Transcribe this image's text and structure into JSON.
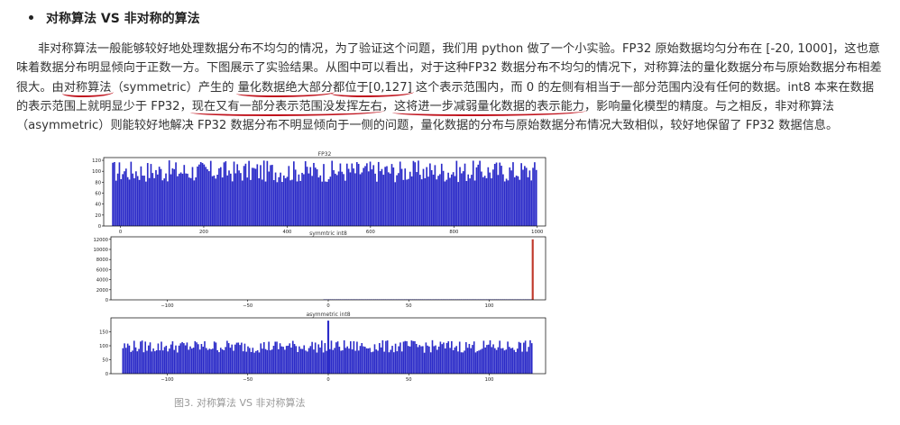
{
  "heading": "对称算法 VS 非对称的算法",
  "paragraph": [
    {
      "t": "非对称算法一般能够较好地处理数据分布不均匀的情况，为了验证这个问题，我们用 python 做了一个小实验。FP32 原始数据均匀分布在 [-20, 1000]，这也意味着数据分布明显倾向于正数一方。下图展示了实验结果。从图中可以看出，对于这种FP32 数据分布不均匀的情况下，对称算法的量化数据分布与原始数据分布相差很大。由"
    },
    {
      "t": "对称算法",
      "u": true
    },
    {
      "t": "（symmetric）产生的 "
    },
    {
      "t": "量化数据绝大部分",
      "u": true
    },
    {
      "t": "都位于[0,127]",
      "u": true
    },
    {
      "t": " 这个表示范围内，而 0 的左侧有相当于一部分范围内没有任何的数据。int8 本来在数据的表示范围上就明显少于 FP32，"
    },
    {
      "t": "现在又有一部分表示范围没发挥左右",
      "u": true
    },
    {
      "t": "，"
    },
    {
      "t": "这将进一步减弱量化数据的表示能力",
      "u": true
    },
    {
      "t": "，影响量化模型的精度。与之相反，非对称算法（asymmetric）则能较好地解决 FP32 数据分布不明显倾向于一侧的问题，量化数据的分布与原始数据分布情况大致相似，较好地保留了 FP32 数据信息。"
    }
  ],
  "caption": "图3. 对称算法 VS 非对称算法",
  "colors": {
    "bar": "#2b2bc8",
    "spike": "#c0392b"
  },
  "chart_data": [
    {
      "type": "bar",
      "title": "FP32",
      "xlim": [
        -40,
        1020
      ],
      "ylim": [
        0,
        125
      ],
      "xticks": [
        0,
        200,
        400,
        600,
        800,
        1000
      ],
      "yticks": [
        0,
        20,
        40,
        60,
        80,
        100,
        120
      ],
      "bins": {
        "start": -20,
        "end": 1000,
        "count": 256,
        "typical": 100,
        "min": 80,
        "max": 120
      }
    },
    {
      "type": "bar",
      "title": "symmtric int8",
      "xlim": [
        -135,
        135
      ],
      "ylim": [
        0,
        12500
      ],
      "xticks": [
        -100,
        -50,
        0,
        50,
        100
      ],
      "yticks": [
        0,
        2000,
        4000,
        6000,
        8000,
        10000,
        12000
      ],
      "bins": {
        "start": -3,
        "end": 127,
        "count": 130,
        "typical": 100
      },
      "spike": {
        "x": 127,
        "value": 12000
      }
    },
    {
      "type": "bar",
      "title": "asymmetric int8",
      "xlim": [
        -135,
        135
      ],
      "ylim": [
        0,
        200
      ],
      "xticks": [
        -100,
        -50,
        0,
        50,
        100
      ],
      "yticks": [
        0,
        50,
        100,
        150
      ],
      "bins": {
        "start": -128,
        "end": 127,
        "count": 256,
        "typical": 100,
        "min": 75,
        "max": 120
      },
      "spike": {
        "x": 0,
        "value": 190
      }
    }
  ]
}
